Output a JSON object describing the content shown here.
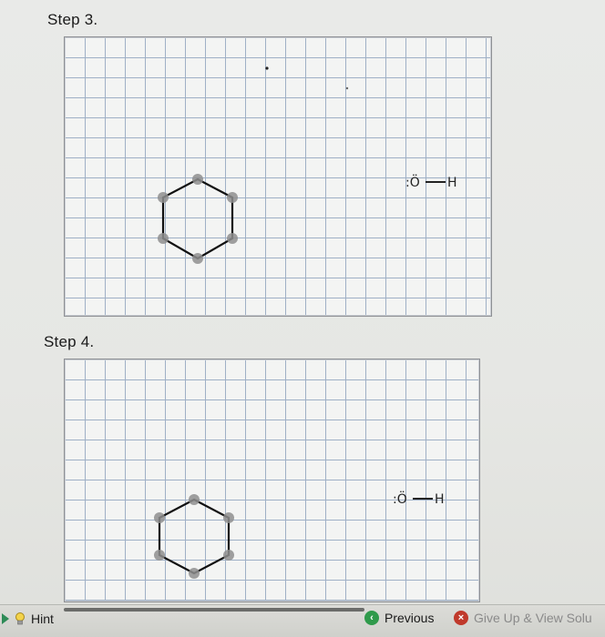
{
  "steps": [
    {
      "label": "Step 3."
    },
    {
      "label": "Step 4."
    }
  ],
  "molecule": {
    "oxygen_label": ":Ö",
    "hydrogen_label": "H"
  },
  "footer": {
    "hint_label": "Hint",
    "previous_label": "Previous",
    "giveup_label": "Give Up & View Solu"
  },
  "colors": {
    "grid_line": "#9fb0c6",
    "ring_bond": "#111111",
    "atom_dot": "#8e8e8e",
    "previous_icon": "#2f9a4b",
    "giveup_icon": "#c0392b"
  },
  "icons": {
    "hint": "lightbulb-icon",
    "hint_arrow": "play-arrow-icon",
    "previous": "previous-circle-icon",
    "giveup": "close-circle-icon"
  }
}
